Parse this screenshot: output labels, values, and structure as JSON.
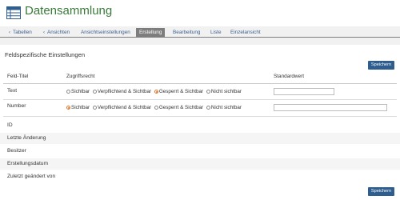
{
  "header": {
    "title": "Datensammlung",
    "icon": "table-icon",
    "accent": "#3a7a3a"
  },
  "tabs": [
    {
      "label": "Tabellen",
      "chevron": "‹",
      "active": false
    },
    {
      "label": "Ansichten",
      "chevron": "‹",
      "active": false
    },
    {
      "label": "Ansichtseinstellungen",
      "active": false
    },
    {
      "label": "Erstellung",
      "active": true
    },
    {
      "label": "Bearbeitung",
      "active": false
    },
    {
      "label": "Liste",
      "active": false
    },
    {
      "label": "Einzelansicht",
      "active": false
    }
  ],
  "section": {
    "title": "Feldspezifische Einstellungen",
    "save_label": "Speichern"
  },
  "columns": {
    "field": "Feld-Titel",
    "access": "Zugriffsrecht",
    "default": "Standardwert"
  },
  "access_options": [
    "Sichtbar",
    "Verpflichtend & Sichtbar",
    "Gesperrt & Sichtbar",
    "Nicht sichtbar"
  ],
  "fields": [
    {
      "title": "Text",
      "selected": "Gesperrt & Sichtbar",
      "default_value": ""
    },
    {
      "title": "Number",
      "selected": "Sichtbar",
      "default_value": ""
    }
  ],
  "meta_fields": [
    "ID",
    "Letzte Änderung",
    "Besitzer",
    "Erstellungsdatum",
    "Zuletzt geändert von"
  ],
  "colors": {
    "save_button": "#2f5e8e",
    "active_tab": "#7d7d7d",
    "radio_selected": "#e0772c",
    "link": "#3c5f8c"
  }
}
